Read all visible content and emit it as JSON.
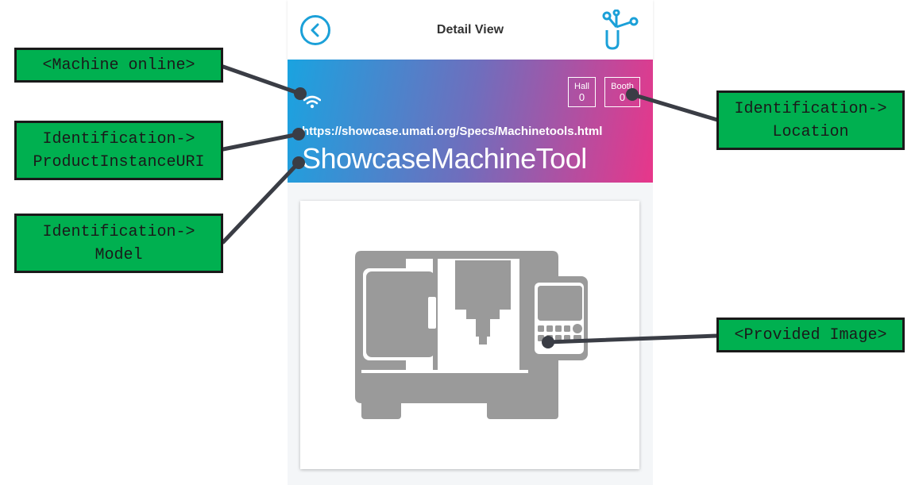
{
  "header": {
    "title": "Detail View",
    "back_icon": "chevron-left-icon",
    "logo_icon": "umati-logo-icon"
  },
  "banner": {
    "status_icon": "wifi-icon",
    "hall_label": "Hall",
    "hall_value": "0",
    "booth_label": "Booth",
    "booth_value": "0",
    "product_instance_uri": "https://showcase.umati.org/Specs/Machinetools.html",
    "model": "ShowcaseMachineTool"
  },
  "image_card": {
    "icon": "cnc-machine-icon"
  },
  "annotations": {
    "machine_online": "<Machine online>",
    "product_instance_uri": "Identification->\nProductInstanceURI",
    "model": "Identification->\nModel",
    "location": "Identification->\nLocation",
    "provided_image": "<Provided Image>"
  },
  "colors": {
    "accent": "#1ba0d8",
    "gradient_start": "#1aa3e0",
    "gradient_end": "#e8368a",
    "annotation_bg": "#00b050",
    "machine_gray": "#9a9a9a"
  }
}
